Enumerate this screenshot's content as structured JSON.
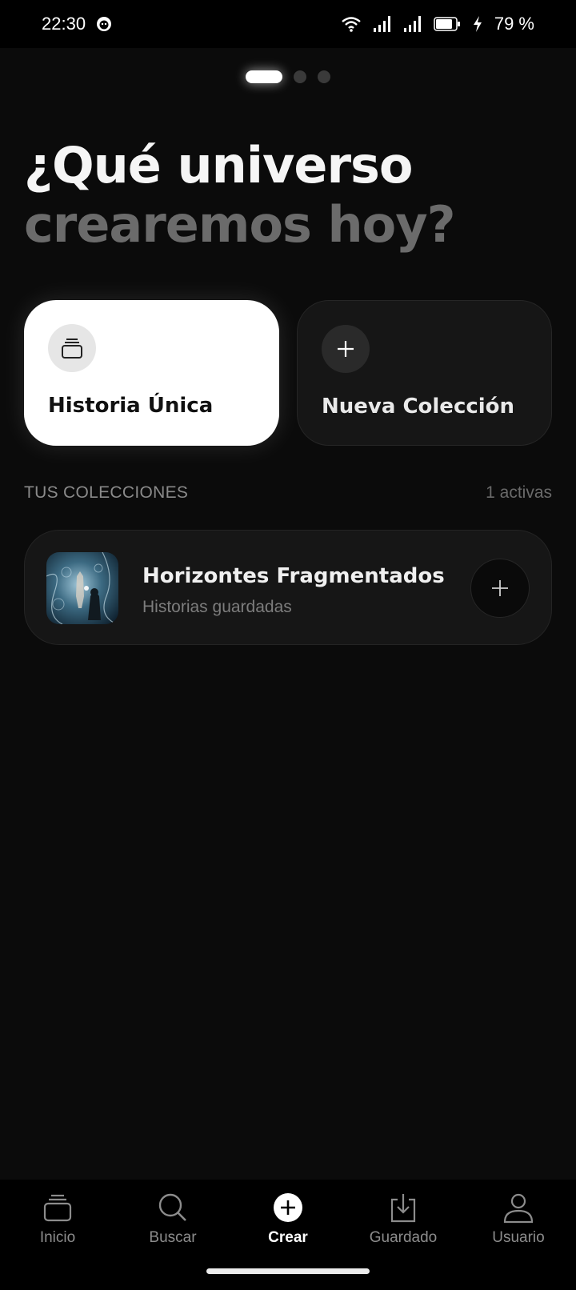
{
  "status_bar": {
    "time": "22:30",
    "battery_percent": "79 %",
    "icons": [
      "face-icon",
      "wifi-icon",
      "signal-icon",
      "signal-icon",
      "battery-icon",
      "charging-icon"
    ]
  },
  "pager": {
    "pages": 3,
    "active": 0
  },
  "headline": {
    "line1": "¿Qué universo",
    "line2": "crearemos hoy?"
  },
  "actions": {
    "single_story": {
      "label": "Historia Única",
      "icon": "stack-icon"
    },
    "new_collection": {
      "label": "Nueva Colección",
      "icon": "plus-icon"
    }
  },
  "collections_section": {
    "title": "TUS COLECCIONES",
    "count": "1 activas",
    "items": [
      {
        "title": "Horizontes Fragmentados",
        "subtitle": "Historias guardadas",
        "thumbnail": "fantasy-scene-image"
      }
    ]
  },
  "bottom_nav": {
    "items": [
      {
        "label": "Inicio",
        "icon": "stack-icon"
      },
      {
        "label": "Buscar",
        "icon": "search-icon"
      },
      {
        "label": "Crear",
        "icon": "plus-circle-icon",
        "active": true
      },
      {
        "label": "Guardado",
        "icon": "download-icon"
      },
      {
        "label": "Usuario",
        "icon": "user-icon"
      }
    ]
  },
  "colors": {
    "background": "#0b0b0b",
    "card_primary": "#ffffff",
    "card_secondary": "#161616",
    "muted_text": "#6b6b6b"
  }
}
